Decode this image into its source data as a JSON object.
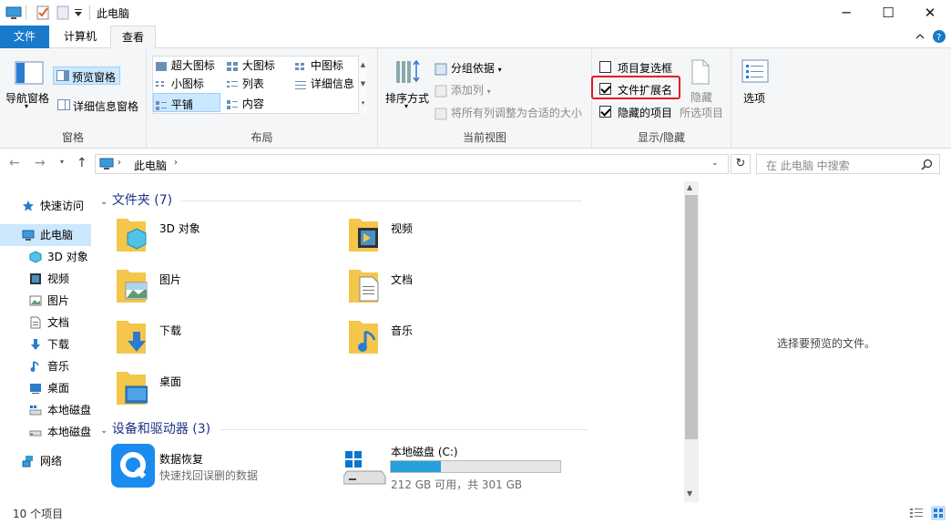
{
  "window": {
    "title": "此电脑",
    "minimize_glyph": "─",
    "maximize_glyph": "☐",
    "close_glyph": "✕"
  },
  "tabs": [
    {
      "label": "文件"
    },
    {
      "label": "计算机"
    },
    {
      "label": "查看"
    }
  ],
  "ribbon": {
    "pane_group": {
      "nav_pane": "导航窗格",
      "preview_pane": "预览窗格",
      "details_pane": "详细信息窗格",
      "label": "窗格"
    },
    "layout_group": {
      "items": [
        {
          "label": "超大图标"
        },
        {
          "label": "大图标"
        },
        {
          "label": "中图标"
        },
        {
          "label": "小图标"
        },
        {
          "label": "列表"
        },
        {
          "label": "详细信息"
        },
        {
          "label": "平铺"
        },
        {
          "label": "内容"
        }
      ],
      "selected": "平铺",
      "label": "布局"
    },
    "view_group": {
      "sort_by": "排序方式",
      "group_by": "分组依据",
      "add_column": "添加列",
      "size_columns": "将所有列调整为合适的大小",
      "label": "当前视图"
    },
    "show_hide_group": {
      "item_checkboxes": {
        "label": "项目复选框",
        "checked": false
      },
      "file_extensions": {
        "label": "文件扩展名",
        "checked": true
      },
      "hidden_items": {
        "label": "隐藏的项目",
        "checked": true
      },
      "hide_selected": "隐藏",
      "hide_selected_2": "所选项目",
      "label": "显示/隐藏"
    },
    "options": "选项",
    "highlight_color": "#e81123"
  },
  "address": {
    "path": "此电脑",
    "search_placeholder": "在 此电脑 中搜索"
  },
  "nav": [
    {
      "label": "快速访问"
    },
    {
      "label": "此电脑"
    },
    {
      "label": "3D 对象"
    },
    {
      "label": "视频"
    },
    {
      "label": "图片"
    },
    {
      "label": "文档"
    },
    {
      "label": "下载"
    },
    {
      "label": "音乐"
    },
    {
      "label": "桌面"
    },
    {
      "label": "本地磁盘"
    },
    {
      "label": "本地磁盘"
    },
    {
      "label": "网络"
    }
  ],
  "folders_section": "文件夹 (7)",
  "folders": [
    {
      "label": "3D 对象"
    },
    {
      "label": "视频"
    },
    {
      "label": "图片"
    },
    {
      "label": "文档"
    },
    {
      "label": "下载"
    },
    {
      "label": "音乐"
    },
    {
      "label": "桌面"
    }
  ],
  "devices_section": "设备和驱动器 (3)",
  "devices": [
    {
      "name": "数据恢复",
      "desc": "快速找回误删的数据"
    },
    {
      "name": "本地磁盘 (C:)",
      "desc": "212 GB 可用，共 301 GB",
      "used_fraction": 0.296
    }
  ],
  "preview_text": "选择要预览的文件。",
  "status": "10 个项目",
  "colors": {
    "accent": "#1979ca",
    "selection": "#cce8ff",
    "folder": "#f4c64c",
    "drive_bar": "#26a0da"
  }
}
